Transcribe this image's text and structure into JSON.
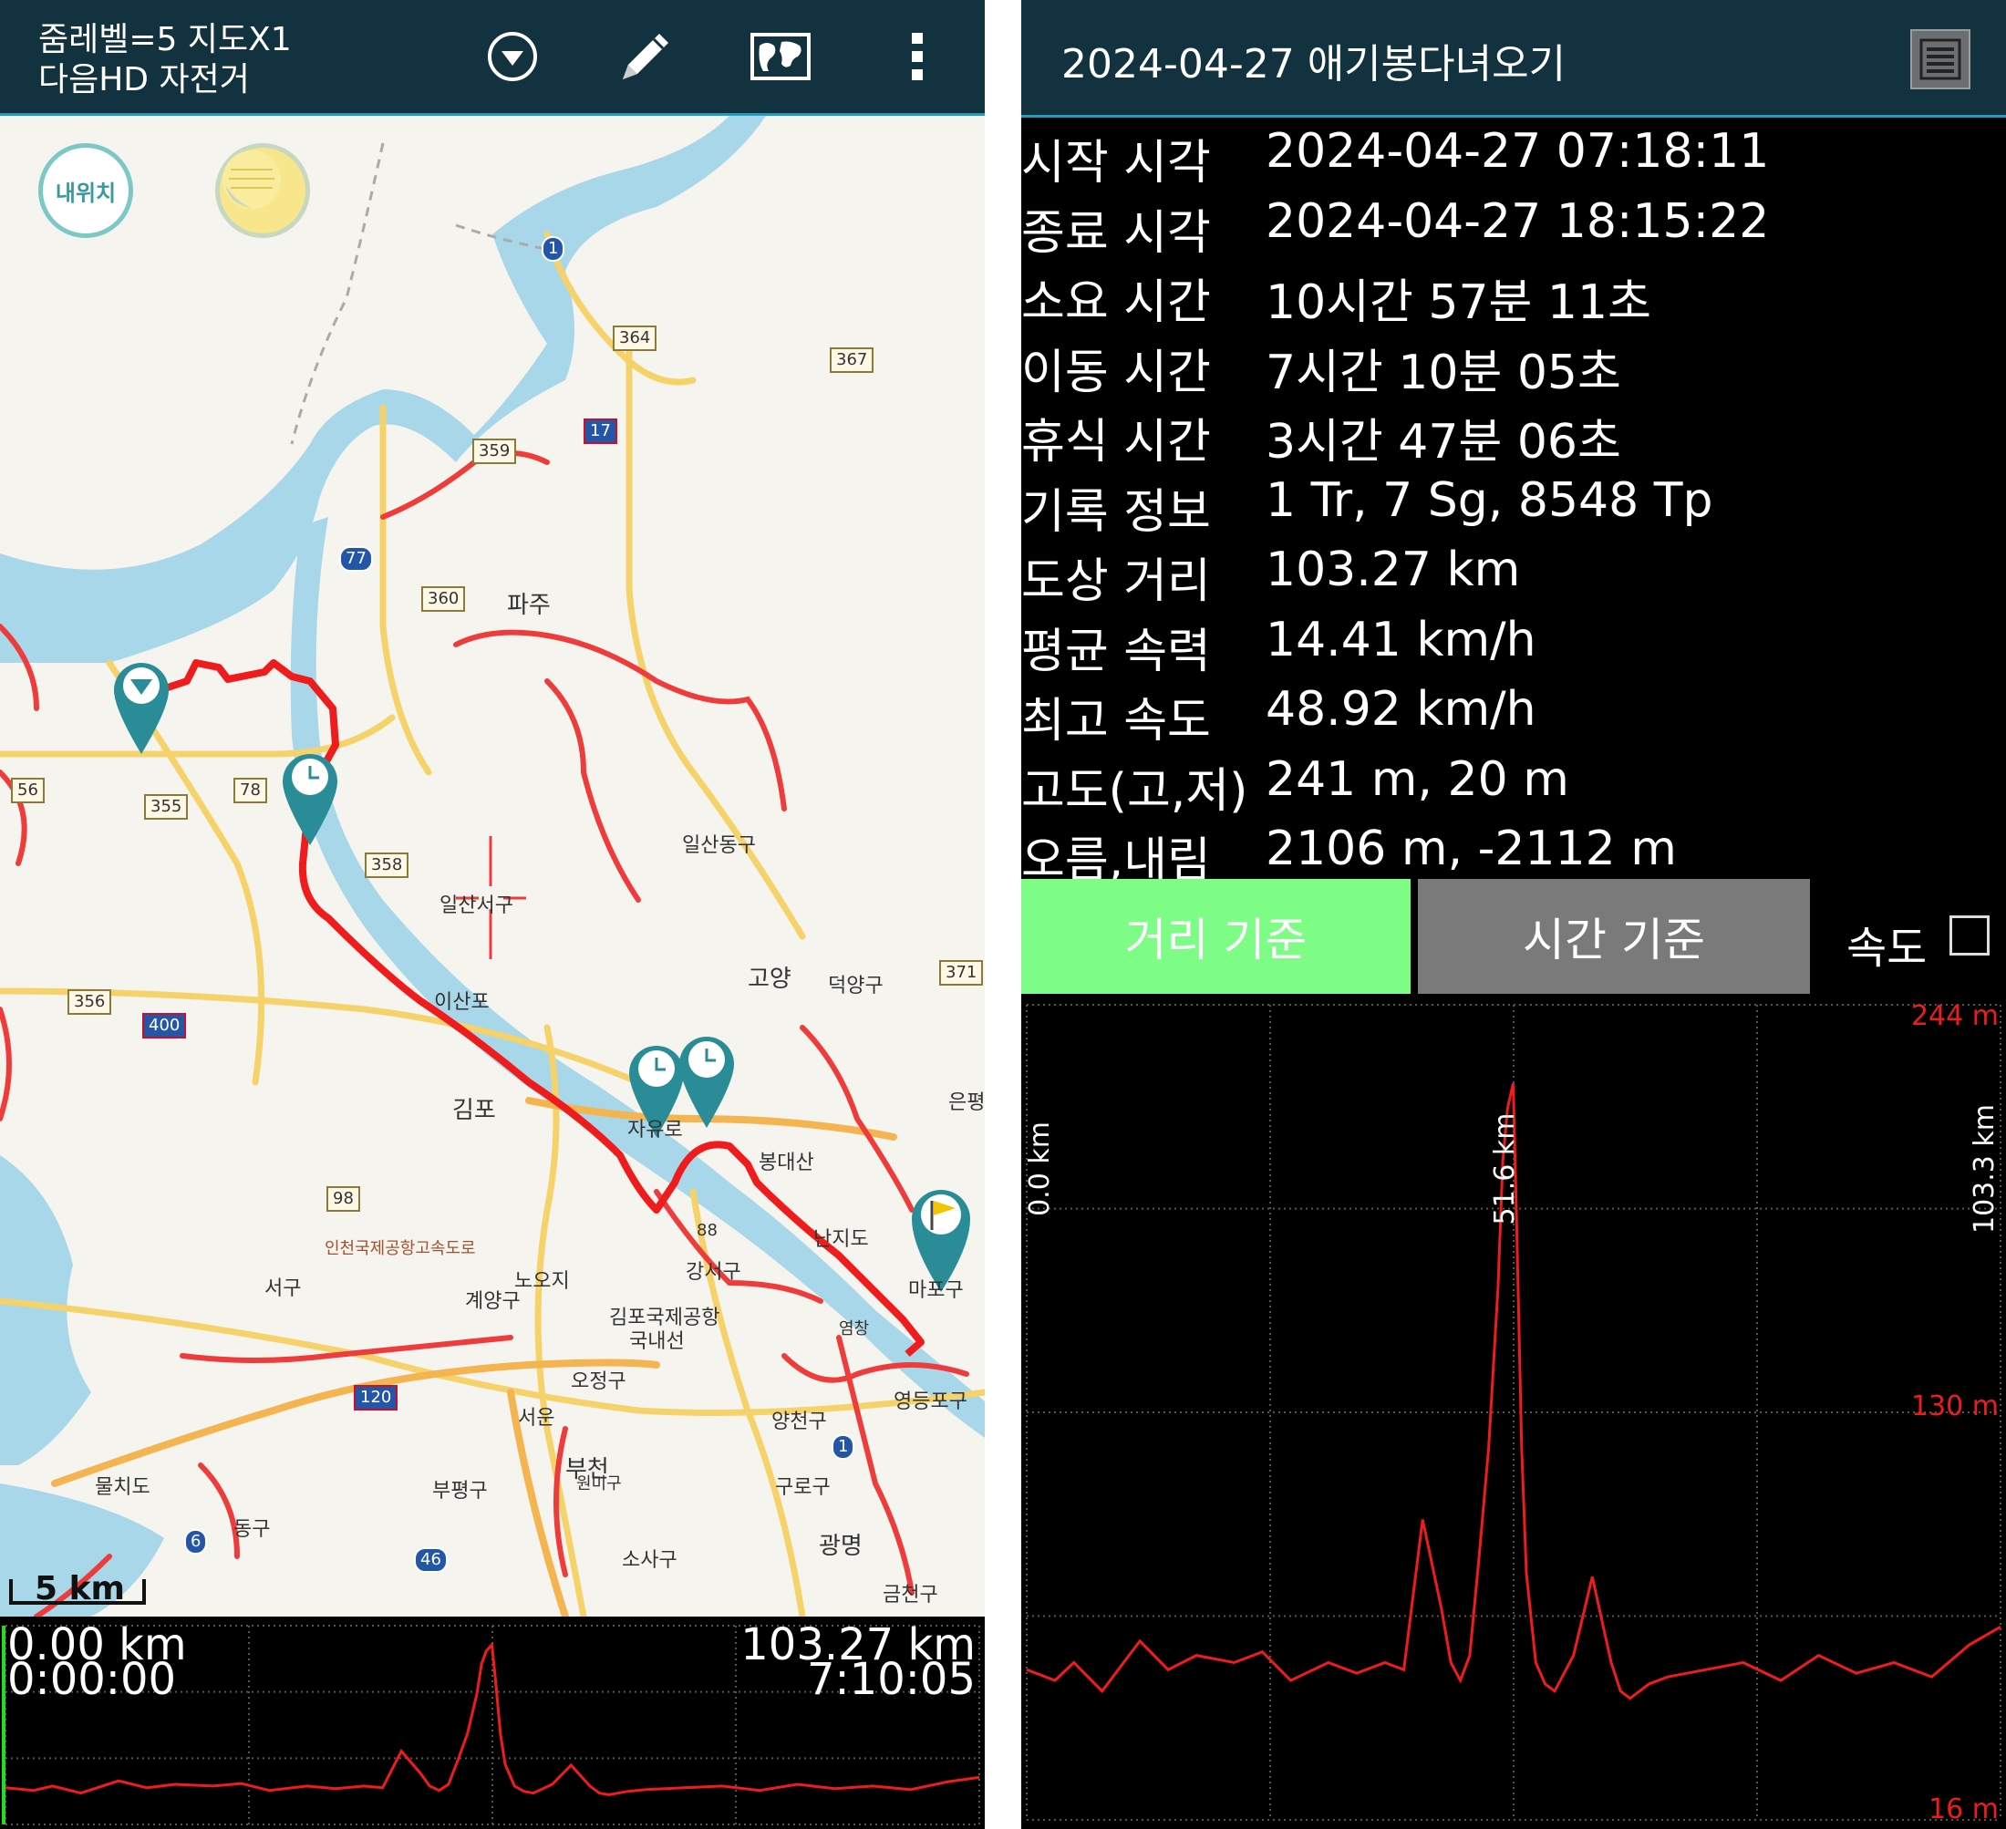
{
  "map_screen": {
    "zoom_text": "줌레벨=5 지도X1",
    "map_type_text": "다음HD 자전거",
    "toolbar": {
      "dropdown_icon": "chevron-down-circle-icon",
      "edit_icon": "pencil-icon",
      "map_icon": "world-map-icon",
      "more_icon": "more-vertical-icon"
    },
    "my_location_label": "내위치",
    "scale_label": "5 km",
    "place_labels": [
      "파주",
      "일산동구",
      "일산서구",
      "이산포",
      "고양",
      "덕양구",
      "김포",
      "자유로",
      "봉대산",
      "난지도",
      "마포구",
      "강서구",
      "88",
      "노오지",
      "계양구",
      "서구",
      "김포국제공항",
      "국내선",
      "오정구",
      "서운",
      "부천",
      "원미구",
      "부평구",
      "양천구",
      "영등포구",
      "구로구",
      "광명",
      "소사구",
      "금천구",
      "물치도",
      "동구",
      "인천국제공항고속도로",
      "염창",
      "은평"
    ],
    "road_numbers": [
      "1",
      "364",
      "367",
      "17",
      "359",
      "77",
      "360",
      "56",
      "355",
      "78",
      "358",
      "371",
      "356",
      "400",
      "98",
      "120",
      "1",
      "6",
      "46"
    ],
    "colors": {
      "track": "#ee1c1c",
      "marker": "#2a8c96",
      "header": "#12323f",
      "water": "#a9d7ea"
    },
    "mini_profile": {
      "start_distance": "0.00 km",
      "start_time": "0:00:00",
      "end_distance": "103.27 km",
      "end_time": "7:10:05"
    }
  },
  "stats_screen": {
    "title": "2024-04-27 애기봉다녀오기",
    "menu_icon": "list-menu-icon",
    "stats": [
      {
        "label": "시작 시각",
        "value": "2024-04-27 07:18:11"
      },
      {
        "label": "종료 시각",
        "value": "2024-04-27 18:15:22"
      },
      {
        "label": "소요 시간",
        "value": "10시간 57분 11초"
      },
      {
        "label": "이동 시간",
        "value": "7시간 10분 05초"
      },
      {
        "label": "휴식 시간",
        "value": "3시간 47분 06초"
      },
      {
        "label": "기록 정보",
        "value": "1 Tr, 7 Sg, 8548 Tp"
      },
      {
        "label": "도상 거리",
        "value": "103.27 km"
      },
      {
        "label": "평균 속력",
        "value": "14.41 km/h"
      },
      {
        "label": "최고 속도",
        "value": "48.92 km/h"
      },
      {
        "label": "고도(고,저)",
        "value": "241 m, 20 m"
      },
      {
        "label": "오름,내림",
        "value": "2106 m, -2112 m"
      }
    ],
    "buttons": {
      "distance": "거리 기준",
      "time": "시간 기준",
      "speed": "속도"
    },
    "speed_checked": false,
    "colors": {
      "active_button": "#7dfc86",
      "inactive_button": "#7a7a7a",
      "profile_line": "#ee1c1c"
    }
  },
  "chart_data": {
    "type": "line",
    "xlabel": "",
    "ylabel": "",
    "x_tick_labels": [
      "0.0 km",
      "51.6 km",
      "103.3 km"
    ],
    "y_tick_labels": [
      "244 m",
      "130 m",
      "16 m"
    ],
    "xlim": [
      0,
      103.3
    ],
    "ylim": [
      16,
      244
    ],
    "grid": true,
    "series": [
      {
        "x": [
          0,
          3,
          5,
          8,
          12,
          15,
          18,
          22,
          25,
          28,
          32,
          35,
          38,
          40,
          42,
          44,
          45,
          46,
          47,
          48,
          49,
          50,
          50.5,
          51,
          51.6,
          52,
          52.5,
          53,
          54,
          55,
          56,
          58,
          60,
          62,
          63,
          64,
          66,
          68,
          72,
          76,
          80,
          84,
          88,
          92,
          96,
          100,
          103.3
        ],
        "y": [
          58,
          55,
          60,
          52,
          66,
          58,
          62,
          60,
          63,
          55,
          60,
          57,
          60,
          58,
          100,
          75,
          60,
          55,
          62,
          90,
          120,
          165,
          200,
          215,
          222,
          180,
          120,
          85,
          60,
          54,
          52,
          62,
          84,
          60,
          52,
          50,
          54,
          56,
          58,
          60,
          55,
          62,
          57,
          60,
          56,
          65,
          70
        ]
      }
    ]
  }
}
